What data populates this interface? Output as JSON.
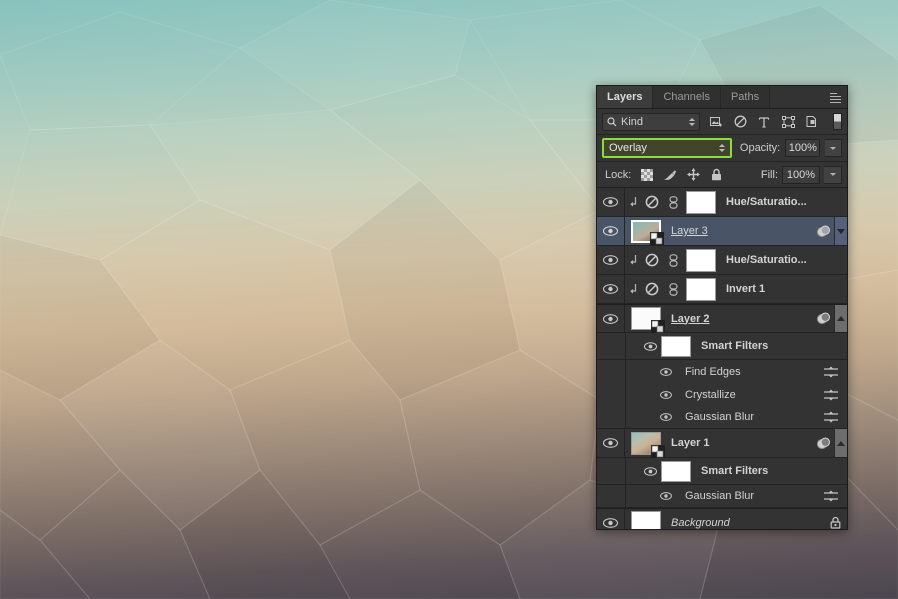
{
  "panel": {
    "title": "Layers",
    "tabs": [
      {
        "label": "Layers",
        "active": true
      },
      {
        "label": "Channels",
        "active": false
      },
      {
        "label": "Paths",
        "active": false
      }
    ],
    "menu_icon": "panel-menu-icon"
  },
  "filter_bar": {
    "kind_label": "Kind",
    "search_icon": "search-icon",
    "icons": [
      {
        "name": "pixel-layer-filter-icon"
      },
      {
        "name": "adjustment-layer-filter-icon"
      },
      {
        "name": "type-layer-filter-icon"
      },
      {
        "name": "shape-layer-filter-icon"
      },
      {
        "name": "smart-object-filter-icon"
      }
    ],
    "toggle_name": "filter-enable-toggle"
  },
  "blend": {
    "mode": "Overlay",
    "opacity_label": "Opacity:",
    "opacity_value": "100%",
    "highlight_color": "#8ddd3c",
    "field_bg": "#41452c"
  },
  "lock": {
    "label": "Lock:",
    "items": [
      {
        "name": "lock-transparent-pixels-icon"
      },
      {
        "name": "lock-image-pixels-icon"
      },
      {
        "name": "lock-position-icon"
      },
      {
        "name": "lock-all-icon"
      }
    ],
    "fill_label": "Fill:",
    "fill_value": "100%"
  },
  "layers": [
    {
      "id": "hue-saturation-top",
      "name": "Hue/Saturatio...",
      "type": "adjustment",
      "visible": true,
      "clipped": true,
      "linked": true,
      "selected": false
    },
    {
      "id": "layer-3",
      "name": "Layer 3",
      "type": "smart-object",
      "visible": true,
      "selected": true,
      "renaming": true,
      "has_smart_filters": true,
      "expanded": false,
      "thumb_style": "grad3"
    },
    {
      "id": "hue-saturation-lower",
      "name": "Hue/Saturatio...",
      "type": "adjustment",
      "visible": true,
      "clipped": true,
      "linked": true,
      "selected": false
    },
    {
      "id": "invert-1",
      "name": "Invert 1",
      "type": "adjustment",
      "visible": true,
      "clipped": true,
      "linked": true,
      "selected": false
    },
    {
      "id": "layer-2",
      "name": "Layer 2",
      "type": "smart-object",
      "visible": true,
      "selected": false,
      "renaming": true,
      "has_smart_filters": true,
      "expanded": true,
      "thumb_style": "whiteish",
      "smart_filters": {
        "group_label": "Smart Filters",
        "group_visible": true,
        "items": [
          {
            "name": "Find Edges",
            "visible": true
          },
          {
            "name": "Crystallize",
            "visible": true
          },
          {
            "name": "Gaussian Blur",
            "visible": true
          }
        ]
      }
    },
    {
      "id": "layer-1",
      "name": "Layer 1",
      "type": "smart-object",
      "visible": true,
      "selected": false,
      "renaming": false,
      "has_smart_filters": true,
      "expanded": true,
      "thumb_style": "grad1",
      "smart_filters": {
        "group_label": "Smart Filters",
        "group_visible": true,
        "items": [
          {
            "name": "Gaussian Blur",
            "visible": true
          }
        ]
      }
    },
    {
      "id": "background",
      "name": "Background",
      "type": "background",
      "visible": true,
      "selected": false,
      "locked": true
    }
  ]
}
